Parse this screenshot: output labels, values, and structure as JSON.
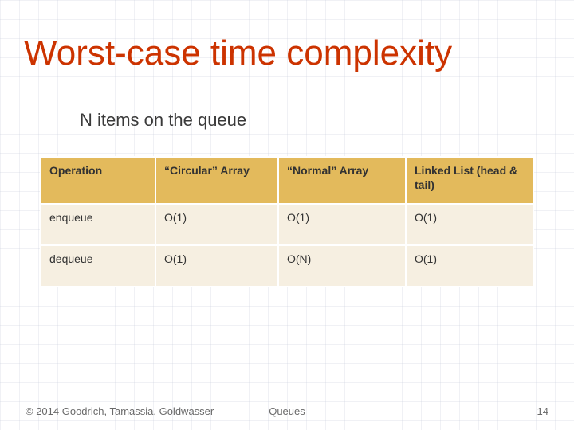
{
  "title": "Worst-case time complexity",
  "subhead": "N items on the queue",
  "table": {
    "headers": [
      "Operation",
      "“Circular” Array",
      "“Normal” Array",
      "Linked List (head & tail)"
    ],
    "rows": [
      {
        "op": "enqueue",
        "cells": [
          "O(1)",
          "O(1)",
          "O(1)"
        ]
      },
      {
        "op": "dequeue",
        "cells": [
          "O(1)",
          "O(N)",
          "O(1)"
        ]
      }
    ]
  },
  "footer": {
    "left": "© 2014 Goodrich, Tamassia, Goldwasser",
    "center": "Queues",
    "right": "14"
  }
}
